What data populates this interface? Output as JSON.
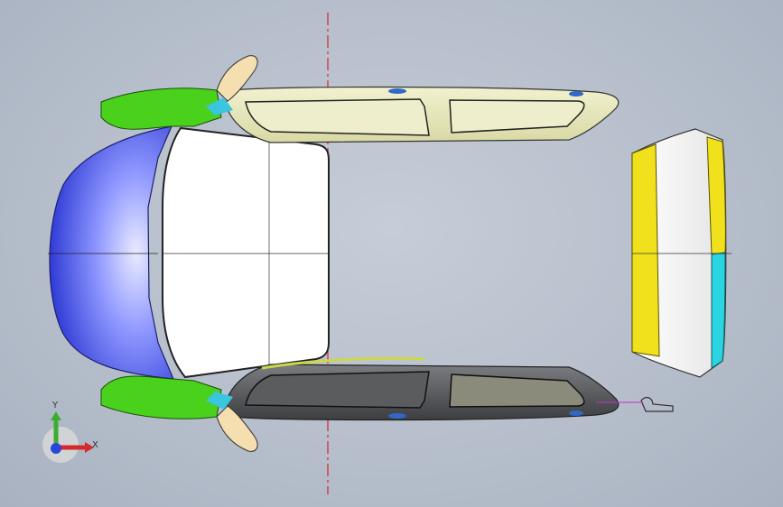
{
  "viewport": {
    "name": "3d-model-viewport",
    "background_top": "#c6cdd8",
    "background_bottom": "#a9b2c1"
  },
  "triad": {
    "y_label": "Y",
    "x_label": "X",
    "y_color": "#3cae2e",
    "x_color": "#d62a2a",
    "z_color": "#2847d8"
  },
  "model": {
    "parts": [
      "front-bumper",
      "hood",
      "windshield",
      "roof-panel",
      "left-fender",
      "right-fender",
      "left-door-panel",
      "right-door-panel",
      "left-mirror",
      "right-mirror",
      "tailgate",
      "rear-hinge"
    ],
    "colors": {
      "bumper": "#4d58e6",
      "fender": "#49d11c",
      "door_upper": "#e6e6b8",
      "door_lower": "#5f6163",
      "tailgate_left": "#f0e11c",
      "tailgate_right": "#2ad4e0",
      "centerline": "#d8232a"
    }
  }
}
